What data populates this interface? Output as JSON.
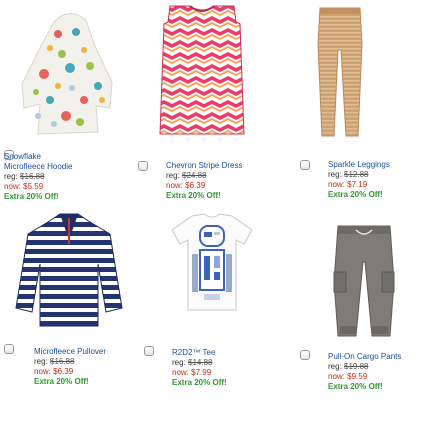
{
  "products": [
    {
      "name_lines": [
        "Snowflake",
        "Microfleece Hoodie"
      ],
      "reg_prefix": "reg: ",
      "reg_price": "$16.88",
      "now": "now: $5.59",
      "offer": "Extra 20% Off!",
      "image": "snowflake-hoodie-photo"
    },
    {
      "name_lines": [
        "Chevron Stripe Dress"
      ],
      "reg_prefix": "reg: ",
      "reg_price": "$24.88",
      "now": "now: $6.39",
      "offer": "Extra 20% Off!",
      "image": "chevron-dress-photo"
    },
    {
      "name_lines": [
        "Sparkle Leggings"
      ],
      "reg_prefix": "reg: ",
      "reg_price": "$12.88",
      "now": "now: $7.19",
      "offer": "Extra 20% Off!",
      "image": "sparkle-leggings-photo"
    },
    {
      "name_lines": [
        "Microfleece Pullover"
      ],
      "reg_prefix": "reg: ",
      "reg_price": "$16.88",
      "now": "now: $6.39",
      "offer": "Extra 20% Off!",
      "image": "striped-pullover-photo"
    },
    {
      "name_lines": [
        "R2D2™ Tee"
      ],
      "reg_prefix": "reg: ",
      "reg_price": "$14.88",
      "now": "now: $7.99",
      "offer": "Extra 20% Off!",
      "image": "r2d2-tee-photo"
    },
    {
      "name_lines": [
        "Pull-On Cargo Pants"
      ],
      "reg_prefix": "reg: ",
      "reg_price": "$19.88",
      "now": "now: $9.59",
      "offer": "Extra 20% Off!",
      "image": "cargo-pants-photo"
    }
  ],
  "colors": {
    "name": "#1a4f9c",
    "now": "#cc2a10",
    "offer": "#2f9a2f"
  }
}
